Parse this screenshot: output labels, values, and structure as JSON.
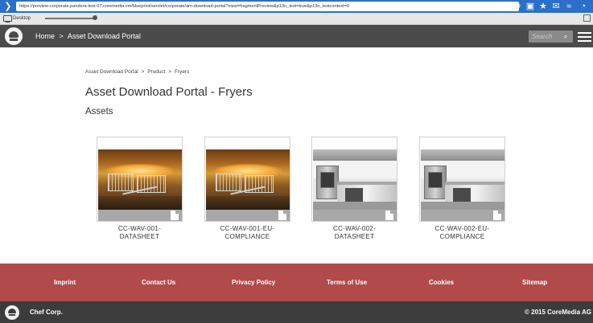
{
  "browser": {
    "url": "https://preview-corporate.pandora-test-07.coremedia.vm/blueprint/servlet/corporate/am-download-portal?view=fragmentPreview&p13n_test=true&p13n_testcontext=0"
  },
  "devbar": {
    "label": "Desktop"
  },
  "header": {
    "home_label": "Home",
    "separator": ">",
    "section_label": "Asset Download Portal",
    "search_placeholder": "Search"
  },
  "breadcrumb": {
    "items": [
      "Asset Download Portal",
      "Product",
      "Fryers"
    ],
    "separator": ">"
  },
  "page": {
    "title": "Asset Download Portal - Fryers",
    "subtitle": "Assets"
  },
  "assets": [
    {
      "label": "CC-WAV-001-DATASHEET",
      "image": "fryer"
    },
    {
      "label": "CC-WAV-001-EU-COMPLIANCE",
      "image": "fryer"
    },
    {
      "label": "CC-WAV-002-DATASHEET",
      "image": "kitchen"
    },
    {
      "label": "CC-WAV-002-EU-COMPLIANCE",
      "image": "kitchen"
    }
  ],
  "asset_label_lines": [
    [
      "CC-WAV-001-",
      "DATASHEET"
    ],
    [
      "CC-WAV-001-EU-",
      "COMPLIANCE"
    ],
    [
      "CC-WAV-002-",
      "DATASHEET"
    ],
    [
      "CC-WAV-002-EU-",
      "COMPLIANCE"
    ]
  ],
  "footer": {
    "links": [
      "Imprint",
      "Contact Us",
      "Privacy Policy",
      "Terms of Use",
      "Cookies",
      "Sitemap"
    ],
    "brand": "Chef Corp.",
    "copyright": "© 2015 CoreMedia AG"
  },
  "colors": {
    "header_bg": "#4b4b4b",
    "footer_bg": "#b14a4a",
    "bottom_bar_bg": "#3c3c3c",
    "browser_bar": "#2b6fc8"
  },
  "icons": [
    "chevron-right-icon",
    "refresh-icon",
    "star-icon",
    "mail-icon",
    "chart-icon",
    "clock-icon",
    "monitor-icon",
    "search-icon",
    "hamburger-menu-icon",
    "chef-hat-logo-icon",
    "document-icon"
  ]
}
